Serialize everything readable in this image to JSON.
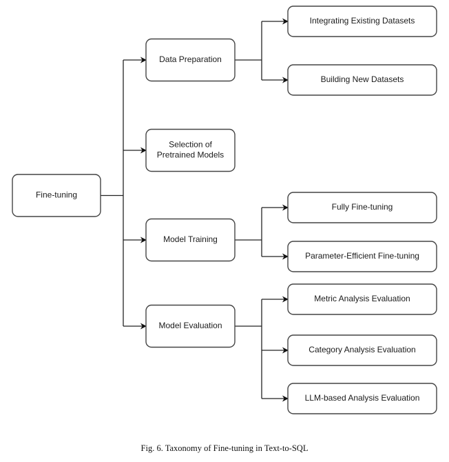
{
  "diagram": {
    "root": {
      "id": "root",
      "label": [
        "Fine-tuning"
      ]
    },
    "level1": [
      {
        "id": "data-preparation",
        "label": [
          "Data Preparation"
        ],
        "children": [
          {
            "id": "integrating-existing-datasets",
            "label": [
              "Integrating Existing Datasets"
            ]
          },
          {
            "id": "building-new-datasets",
            "label": [
              "Building New Datasets"
            ]
          }
        ]
      },
      {
        "id": "selection-of-pretrained-models",
        "label": [
          "Selection of",
          "Pretrained Models"
        ],
        "children": []
      },
      {
        "id": "model-training",
        "label": [
          "Model Training"
        ],
        "children": [
          {
            "id": "fully-fine-tuning",
            "label": [
              "Fully Fine-tuning"
            ]
          },
          {
            "id": "parameter-efficient-fine-tuning",
            "label": [
              "Parameter-Efficient Fine-tuning"
            ]
          }
        ]
      },
      {
        "id": "model-evaluation",
        "label": [
          "Model Evaluation"
        ],
        "children": [
          {
            "id": "metric-analysis-evaluation",
            "label": [
              "Metric Analysis Evaluation"
            ]
          },
          {
            "id": "category-analysis-evaluation",
            "label": [
              "Category Analysis Evaluation"
            ]
          },
          {
            "id": "llm-based-analysis-evaluation",
            "label": [
              "LLM-based Analysis Evaluation"
            ]
          }
        ]
      }
    ]
  },
  "caption": "Fig. 6.  Taxonomy of Fine-tuning in Text-to-SQL"
}
